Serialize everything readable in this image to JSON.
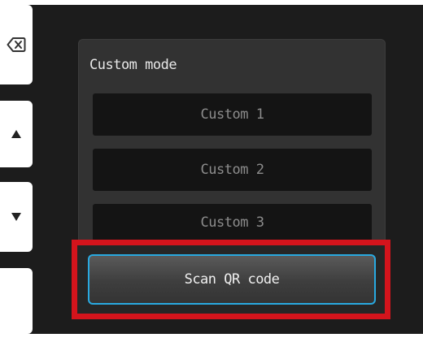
{
  "panel": {
    "title": "Custom mode",
    "items": [
      {
        "label": "Custom 1"
      },
      {
        "label": "Custom 2"
      },
      {
        "label": "Custom 3"
      }
    ],
    "scan_button_label": "Scan QR code"
  },
  "side_buttons": {
    "back_icon": "backspace-icon",
    "up_icon": "arrow-up-icon",
    "down_icon": "arrow-down-icon"
  },
  "colors": {
    "highlight": "#d4141c",
    "scan_button_border": "#29a9e0",
    "panel_background": "#323232",
    "item_background": "#141414"
  }
}
